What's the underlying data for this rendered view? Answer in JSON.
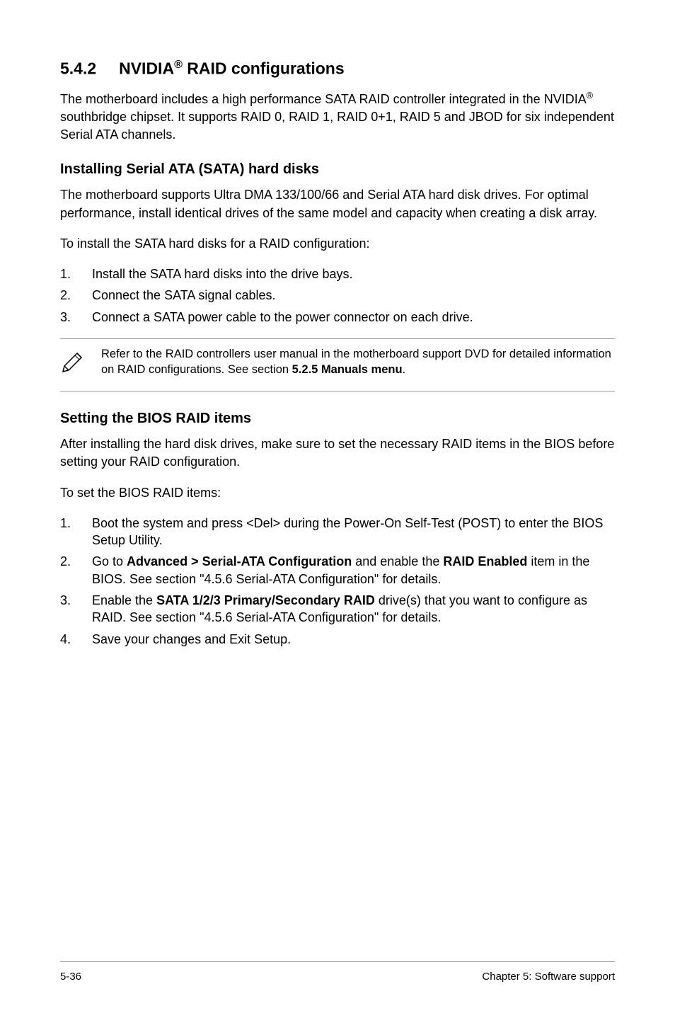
{
  "section": {
    "number": "5.4.2",
    "title_part1": "NVIDIA",
    "title_sup": "®",
    "title_part2": " RAID configurations"
  },
  "intro": {
    "p1_part1": "The motherboard includes a high performance SATA RAID controller integrated in the NVIDIA",
    "p1_sup": "®",
    "p1_part2": " southbridge chipset. It supports RAID 0, RAID 1, RAID 0+1, RAID 5 and JBOD for six independent Serial ATA channels."
  },
  "sub1": {
    "heading": "Installing Serial ATA (SATA) hard disks",
    "p1": "The motherboard supports Ultra DMA 133/100/66 and Serial ATA hard disk drives. For optimal performance, install identical drives of the same model and capacity when creating a disk array.",
    "p2": "To install the SATA hard disks for a RAID configuration:",
    "steps": [
      "Install the SATA hard disks into the drive bays.",
      "Connect the SATA signal cables.",
      "Connect a SATA power cable to the power connector on each drive."
    ]
  },
  "note": {
    "text_part1": "Refer to the RAID controllers user manual in the motherboard support DVD for detailed information on RAID configurations. See section ",
    "text_bold": "5.2.5 Manuals menu",
    "text_part2": "."
  },
  "sub2": {
    "heading": "Setting the BIOS RAID items",
    "p1": "After installing the hard disk drives, make sure to set the necessary RAID items in the BIOS before setting your RAID configuration.",
    "p2": "To set the BIOS RAID items:",
    "steps": [
      {
        "pre": "Boot the system and press <Del> during the Power-On Self-Test (POST) to enter the BIOS Setup Utility.",
        "bold1": "",
        "mid": "",
        "bold2": "",
        "post": ""
      },
      {
        "pre": "Go to ",
        "bold1": "Advanced > Serial-ATA Configuration",
        "mid": " and enable the ",
        "bold2": "RAID Enabled",
        "post": " item in the BIOS. See section \"4.5.6 Serial-ATA Configuration\" for details."
      },
      {
        "pre": "Enable the ",
        "bold1": "SATA 1/2/3 Primary/Secondary RAID",
        "mid": " drive(s) that you want to configure as RAID. See section \"4.5.6 Serial-ATA Configuration\" for details.",
        "bold2": "",
        "post": ""
      },
      {
        "pre": "Save your changes and Exit Setup.",
        "bold1": "",
        "mid": "",
        "bold2": "",
        "post": ""
      }
    ]
  },
  "footer": {
    "left": "5-36",
    "right": "Chapter 5: Software support"
  },
  "step_numbers": [
    "1.",
    "2.",
    "3.",
    "4."
  ]
}
